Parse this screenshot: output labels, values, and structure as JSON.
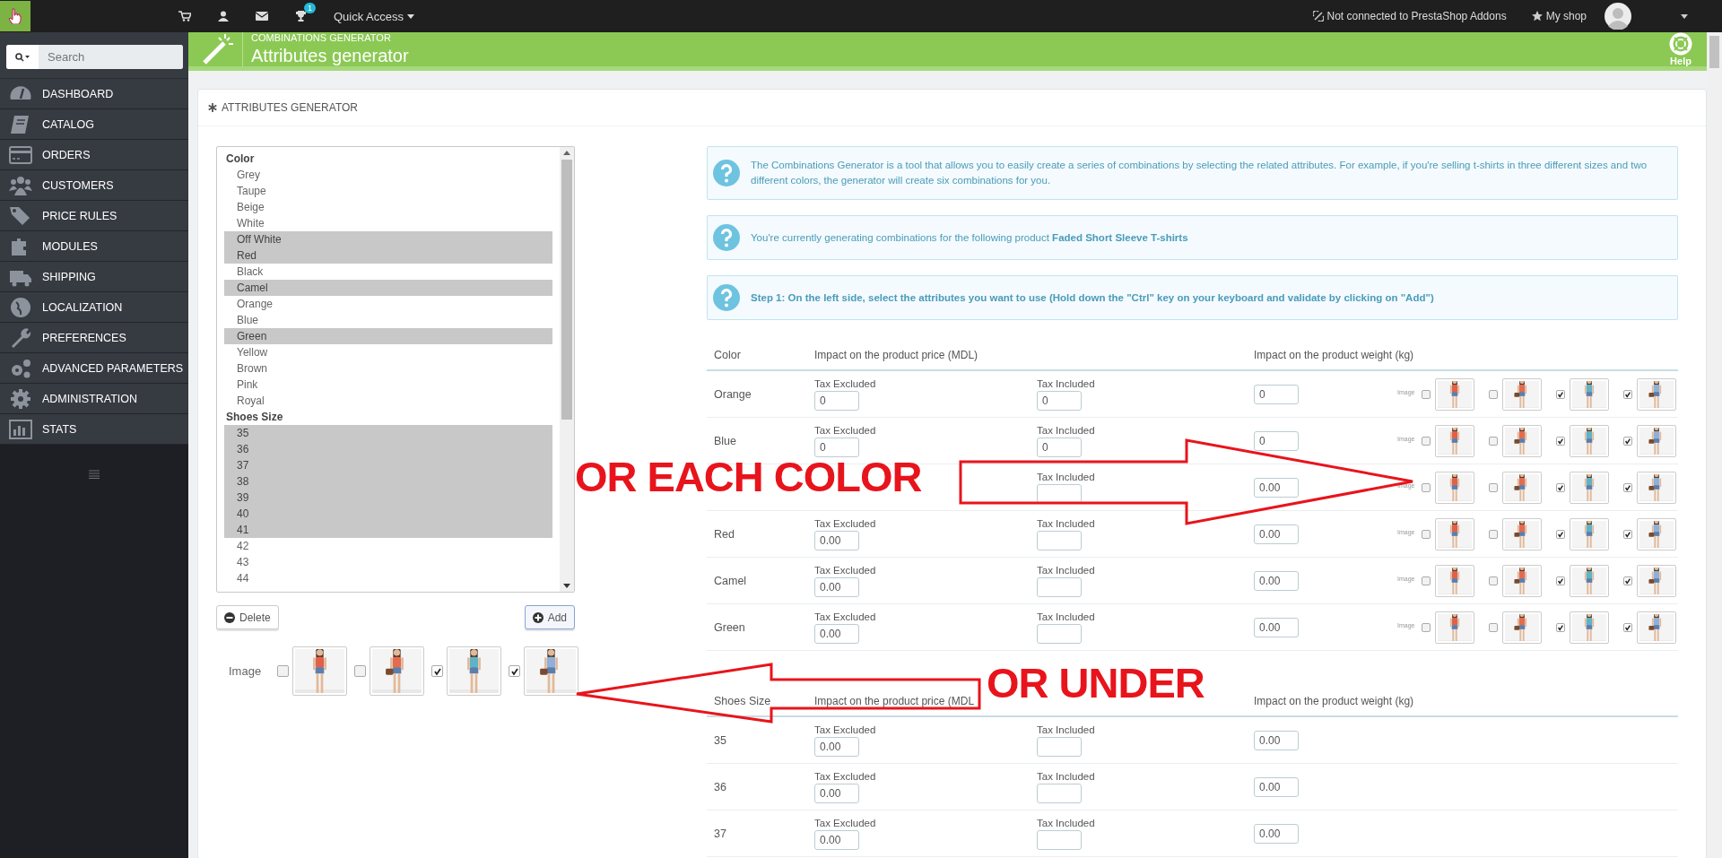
{
  "topbar": {
    "quick_access": "Quick Access",
    "notification_count": "1",
    "addons": "Not connected to PrestaShop Addons",
    "shop": "My shop"
  },
  "sidebar": {
    "search": {
      "placeholder": "Search"
    },
    "items": [
      {
        "label": "DASHBOARD"
      },
      {
        "label": "CATALOG"
      },
      {
        "label": "ORDERS"
      },
      {
        "label": "CUSTOMERS"
      },
      {
        "label": "PRICE RULES"
      },
      {
        "label": "MODULES"
      },
      {
        "label": "SHIPPING"
      },
      {
        "label": "LOCALIZATION"
      },
      {
        "label": "PREFERENCES"
      },
      {
        "label": "ADVANCED PARAMETERS"
      },
      {
        "label": "ADMINISTRATION"
      },
      {
        "label": "STATS"
      }
    ]
  },
  "header": {
    "breadcrumb": "COMBINATIONS GENERATOR",
    "title": "Attributes generator",
    "help": "Help"
  },
  "panel": {
    "title": "ATTRIBUTES GENERATOR"
  },
  "attribute_list": [
    {
      "group": "Color",
      "options": [
        {
          "label": "Grey",
          "selected": false
        },
        {
          "label": "Taupe",
          "selected": false
        },
        {
          "label": "Beige",
          "selected": false
        },
        {
          "label": "White",
          "selected": false
        },
        {
          "label": "Off White",
          "selected": true
        },
        {
          "label": "Red",
          "selected": true
        },
        {
          "label": "Black",
          "selected": false
        },
        {
          "label": "Camel",
          "selected": true
        },
        {
          "label": "Orange",
          "selected": false
        },
        {
          "label": "Blue",
          "selected": false
        },
        {
          "label": "Green",
          "selected": true
        },
        {
          "label": "Yellow",
          "selected": false
        },
        {
          "label": "Brown",
          "selected": false
        },
        {
          "label": "Pink",
          "selected": false
        },
        {
          "label": "Royal",
          "selected": false
        }
      ]
    },
    {
      "group": "Shoes Size",
      "options": [
        {
          "label": "35",
          "selected": true
        },
        {
          "label": "36",
          "selected": true
        },
        {
          "label": "37",
          "selected": true
        },
        {
          "label": "38",
          "selected": true
        },
        {
          "label": "39",
          "selected": true
        },
        {
          "label": "40",
          "selected": true
        },
        {
          "label": "41",
          "selected": true
        },
        {
          "label": "42",
          "selected": false
        },
        {
          "label": "43",
          "selected": false
        },
        {
          "label": "44",
          "selected": false
        }
      ]
    }
  ],
  "buttons": {
    "delete": "Delete",
    "add": "Add"
  },
  "image_picker": {
    "label": "Image",
    "images": [
      {
        "checked": false
      },
      {
        "checked": false
      },
      {
        "checked": true
      },
      {
        "checked": true
      }
    ]
  },
  "alerts": [
    {
      "text": "The Combinations Generator is a tool that allows you to easily create a series of combinations by selecting the related attributes. For example, if you're selling t-shirts in three different sizes and two different colors, the generator will create six combinations for you.",
      "bold": false
    },
    {
      "text": "You're currently generating combinations for the following product **Faded Short Sleeve T-shirts**",
      "bold": false
    },
    {
      "text": "Step 1: On the left side, select the attributes you want to use (Hold down the \"Ctrl\" key on your keyboard and validate by clicking on \"Add\")",
      "bold": true
    }
  ],
  "color_table": {
    "columns": [
      "Color",
      "Impact on the product price (MDL)",
      "Impact on the product weight (kg)"
    ],
    "rows": [
      {
        "name": "Orange",
        "excluded_label": "Tax Excluded",
        "excluded": "0",
        "included_label": "Tax Included",
        "included": "0",
        "weight": "0",
        "image_label": "Image",
        "images": [
          {
            "checked": false
          },
          {
            "checked": false
          },
          {
            "checked": true
          },
          {
            "checked": true
          }
        ]
      },
      {
        "name": "Blue",
        "excluded_label": "Tax Excluded",
        "excluded": "0",
        "included_label": "Tax Included",
        "included": "0",
        "weight": "0",
        "image_label": "Image",
        "images": [
          {
            "checked": false
          },
          {
            "checked": false
          },
          {
            "checked": true
          },
          {
            "checked": true
          }
        ]
      },
      {
        "included_label": "Tax Included",
        "weight": "0.00",
        "image_label": "Image",
        "images": [
          {
            "checked": false
          },
          {
            "checked": false
          },
          {
            "checked": true
          },
          {
            "checked": true
          }
        ]
      },
      {
        "name": "Red",
        "excluded_label": "Tax Excluded",
        "excluded": "0.00",
        "included_label": "Tax Included",
        "weight": "0.00",
        "image_label": "Image",
        "images": [
          {
            "checked": false
          },
          {
            "checked": false
          },
          {
            "checked": true
          },
          {
            "checked": true
          }
        ]
      },
      {
        "name": "Camel",
        "excluded_label": "Tax Excluded",
        "excluded": "0.00",
        "included_label": "Tax Included",
        "weight": "0.00",
        "image_label": "Image",
        "images": [
          {
            "checked": false
          },
          {
            "checked": false
          },
          {
            "checked": true
          },
          {
            "checked": true
          }
        ]
      },
      {
        "name": "Green",
        "excluded_label": "Tax Excluded",
        "excluded": "0.00",
        "included_label": "Tax Included",
        "weight": "0.00",
        "image_label": "Image",
        "images": [
          {
            "checked": false
          },
          {
            "checked": false
          },
          {
            "checked": true
          },
          {
            "checked": true
          }
        ]
      }
    ]
  },
  "size_table": {
    "columns": [
      "Shoes Size",
      "Impact on the product price (MDL",
      "Impact on the product weight (kg)"
    ],
    "rows": [
      {
        "name": "35",
        "excluded_label": "Tax Excluded",
        "excluded": "0.00",
        "included_label": "Tax Included",
        "weight": "0.00"
      },
      {
        "name": "36",
        "excluded_label": "Tax Excluded",
        "excluded": "0.00",
        "included_label": "Tax Included",
        "weight": "0.00"
      },
      {
        "name": "37",
        "excluded_label": "Tax Excluded",
        "excluded": "0.00",
        "included_label": "Tax Included",
        "weight": "0.00"
      }
    ]
  },
  "annotations": [
    "OR EACH COLOR",
    "OR UNDER"
  ]
}
